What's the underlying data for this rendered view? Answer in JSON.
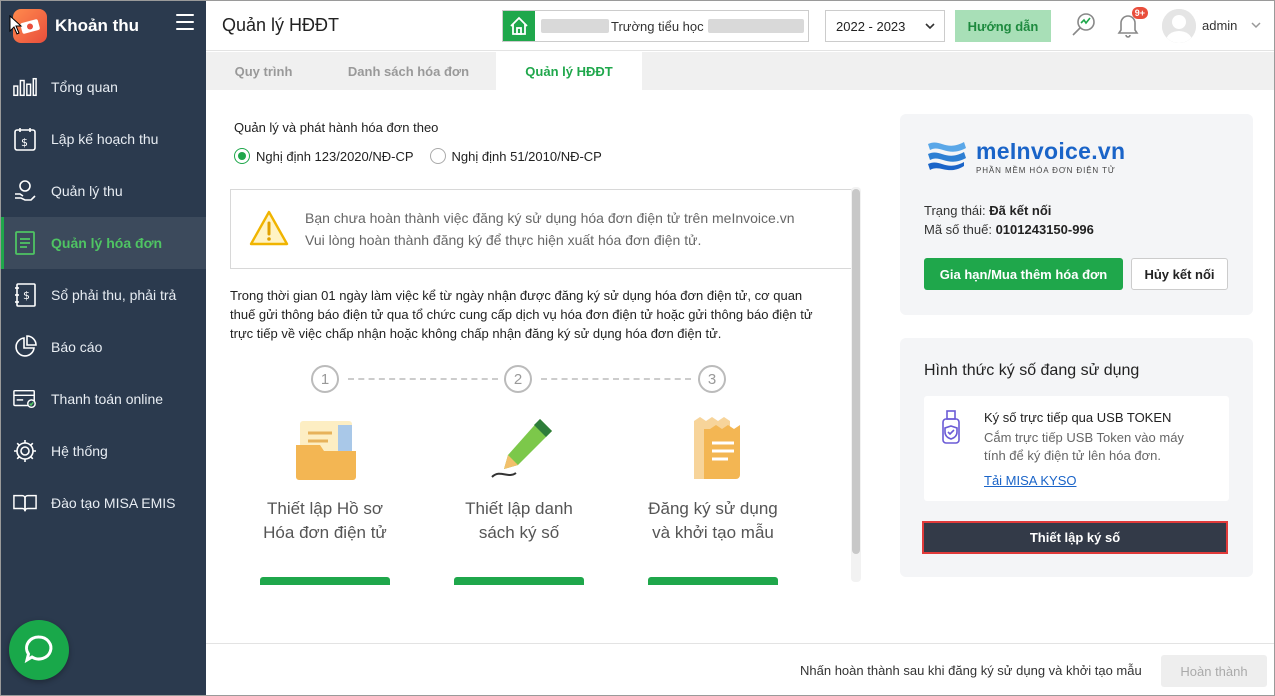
{
  "app": {
    "title": "Khoản thu"
  },
  "sidebar": {
    "items": [
      {
        "label": "Tổng quan",
        "icon": "bar-chart-icon"
      },
      {
        "label": "Lập kế hoạch thu",
        "icon": "calendar-dollar-icon"
      },
      {
        "label": "Quản lý thu",
        "icon": "hand-coin-icon"
      },
      {
        "label": "Quản lý hóa đơn",
        "icon": "invoice-icon",
        "active": true
      },
      {
        "label": "Sổ phải thu, phải trả",
        "icon": "ledger-dollar-icon"
      },
      {
        "label": "Báo cáo",
        "icon": "pie-chart-icon"
      },
      {
        "label": "Thanh toán online",
        "icon": "online-payment-icon"
      },
      {
        "label": "Hệ thống",
        "icon": "gear-icon"
      },
      {
        "label": "Đào tạo MISA EMIS",
        "icon": "book-icon"
      }
    ]
  },
  "header": {
    "page_title": "Quản lý HĐĐT",
    "school_name": "Trường tiểu học",
    "year": "2022 - 2023",
    "guide_label": "Hướng dẫn",
    "notification_badge": "9+",
    "username": "admin"
  },
  "tabs": [
    {
      "label": "Quy trình"
    },
    {
      "label": "Danh sách hóa đơn"
    },
    {
      "label": "Quản lý HĐĐT",
      "active": true
    }
  ],
  "main": {
    "radio_title": "Quản lý và phát hành hóa đơn theo",
    "radio_options": [
      {
        "label": "Nghị định 123/2020/NĐ-CP",
        "checked": true
      },
      {
        "label": "Nghị định 51/2010/NĐ-CP",
        "checked": false
      }
    ],
    "warning_line1": "Bạn chưa hoàn thành việc đăng ký sử dụng hóa đơn điện tử trên meInvoice.vn",
    "warning_line2": "Vui lòng hoàn thành đăng ký để thực hiện xuất hóa đơn điện tử.",
    "paragraph": "Trong thời gian 01 ngày làm việc kể từ ngày nhận được đăng ký sử dụng hóa đơn điện tử, cơ quan thuế gửi thông báo điện tử qua tổ chức cung cấp dịch vụ hóa đơn điện tử hoặc gửi thông báo điện tử trực tiếp về việc chấp nhận hoặc không chấp nhận đăng ký sử dụng hóa đơn điện tử.",
    "steps": [
      {
        "num": "1",
        "line1": "Thiết lập Hồ sơ",
        "line2": "Hóa đơn điện tử"
      },
      {
        "num": "2",
        "line1": "Thiết lập danh",
        "line2": "sách ký số"
      },
      {
        "num": "3",
        "line1": "Đăng ký sử dụng",
        "line2": "và khởi tạo mẫu"
      }
    ]
  },
  "meinvoice": {
    "brand": "meInvoice.vn",
    "tagline": "PHẦN MỀM HÓA ĐƠN ĐIỆN TỬ",
    "status_label": "Trạng thái:",
    "status_value": "Đã kết nối",
    "tax_label": "Mã số thuế:",
    "tax_value": "0101243150-996",
    "renew_button": "Gia hạn/Mua thêm hóa đơn",
    "disconnect_button": "Hủy kết nối"
  },
  "signature": {
    "title": "Hình thức ký số đang sử dụng",
    "method_name": "Ký số trực tiếp qua USB TOKEN",
    "method_desc": "Cắm trực tiếp USB Token vào máy tính để ký điện tử lên hóa đơn.",
    "download_link": "Tải MISA KYSO",
    "setup_button": "Thiết lập ký số"
  },
  "footer": {
    "hint": "Nhấn hoàn thành sau khi đăng ký sử dụng và khởi tạo mẫu",
    "finish_button": "Hoàn thành"
  },
  "colors": {
    "sidebar_bg": "#2b3a4e",
    "accent_green": "#1fa74b",
    "link_blue": "#1a64c8",
    "dark_button": "#333a48",
    "highlight_red": "#e03a3a"
  }
}
